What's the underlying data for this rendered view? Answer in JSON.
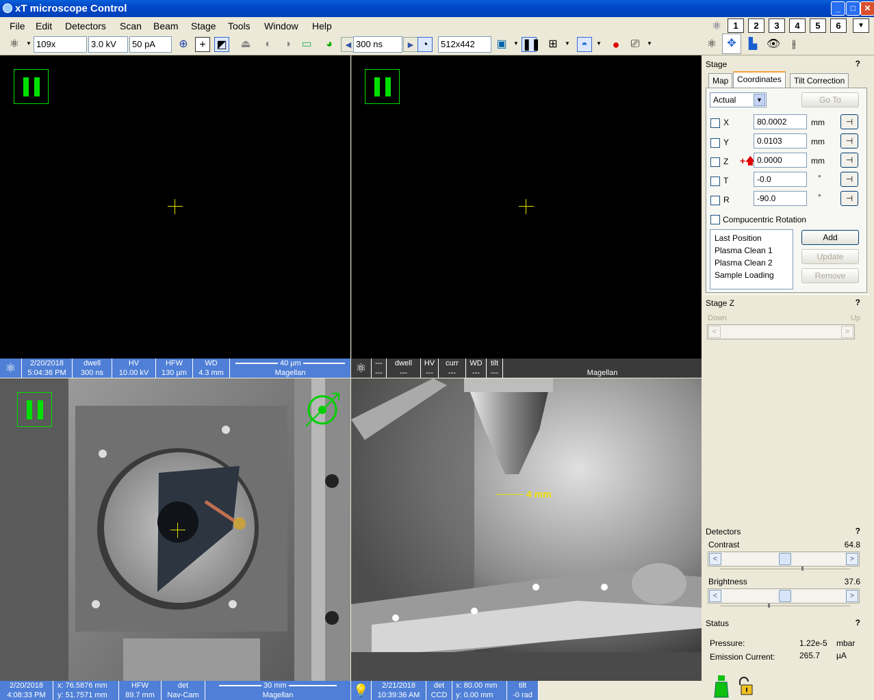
{
  "window": {
    "title": "xT microscope Control"
  },
  "menu": [
    "File",
    "Edit",
    "Detectors",
    "Scan",
    "Beam",
    "Stage",
    "Tools",
    "Window",
    "Help"
  ],
  "presets": [
    "1",
    "2",
    "3",
    "4",
    "5",
    "6"
  ],
  "toolbar": {
    "magnification": "109x",
    "hv": "3.0 kV",
    "current": "50 pA",
    "dwell": "300 ns",
    "resolution": "512x442"
  },
  "quad1": {
    "date": "2/20/2018",
    "time": "5:04:36 PM",
    "dwell_label": "dwell",
    "dwell_value": "300 ns",
    "hv_label": "HV",
    "hv_value": "10.00 kV",
    "hfw_label": "HFW",
    "hfw_value": "130 µm",
    "wd_label": "WD",
    "wd_value": "4.3 mm",
    "scale": "40 µm",
    "brand": "Magellan"
  },
  "quad2": {
    "c1a": "---",
    "c1b": "---",
    "dwell_label": "dwell",
    "dwell_value": "---",
    "hv_label": "HV",
    "hv_value": "---",
    "curr_label": "curr",
    "curr_value": "---",
    "wd_label": "WD",
    "wd_value": "---",
    "tilt_label": "tilt",
    "tilt_value": "---",
    "brand": "Magellan"
  },
  "quad3": {
    "date": "2/20/2018",
    "time": "4:08:33 PM",
    "x": "x: 76.5876 mm",
    "y": "y: 51.7571 mm",
    "hfw_label": "HFW",
    "hfw_value": "89.7 mm",
    "det_label": "det",
    "det_value": "Nav-Cam",
    "scale": "30 mm",
    "brand": "Magellan"
  },
  "quad4": {
    "date": "2/21/2018",
    "time": "10:39:36 AM",
    "det_label": "det",
    "det_value": "CCD",
    "x": "x: 80.00 mm",
    "y": "y: 0.00 mm",
    "tilt_label": "tilt",
    "tilt_value": "-0 rad",
    "scale_label": "4 mm"
  },
  "stage": {
    "title": "Stage",
    "tabs": [
      "Map",
      "Coordinates",
      "Tilt Correction"
    ],
    "mode": "Actual",
    "goto": "Go To",
    "coords": [
      {
        "axis": "X",
        "value": "80.0002",
        "unit": "mm"
      },
      {
        "axis": "Y",
        "value": "0.0103",
        "unit": "mm"
      },
      {
        "axis": "Z",
        "value": "0.0000",
        "unit": "mm"
      },
      {
        "axis": "T",
        "value": "-0.0",
        "unit": "°"
      },
      {
        "axis": "R",
        "value": "-90.0",
        "unit": "°"
      }
    ],
    "compucentric": "Compucentric Rotation",
    "positions": [
      "Last Position",
      "Plasma Clean 1",
      "Plasma Clean 2",
      "Sample Loading"
    ],
    "add": "Add",
    "update": "Update",
    "remove": "Remove"
  },
  "stagez": {
    "title": "Stage Z",
    "down": "Down",
    "up": "Up"
  },
  "detectors": {
    "title": "Detectors",
    "contrast_label": "Contrast",
    "contrast_value": "64.8",
    "brightness_label": "Brightness",
    "brightness_value": "37.6"
  },
  "status": {
    "title": "Status",
    "pressure_label": "Pressure:",
    "pressure_value": "1.22e-5",
    "pressure_unit": "mbar",
    "emission_label": "Emission Current:",
    "emission_value": "265.7",
    "emission_unit": "µA"
  },
  "colors": {
    "accent": "#4f7fd6",
    "pause_green": "#00e000",
    "crosshair": "#e8e000"
  }
}
